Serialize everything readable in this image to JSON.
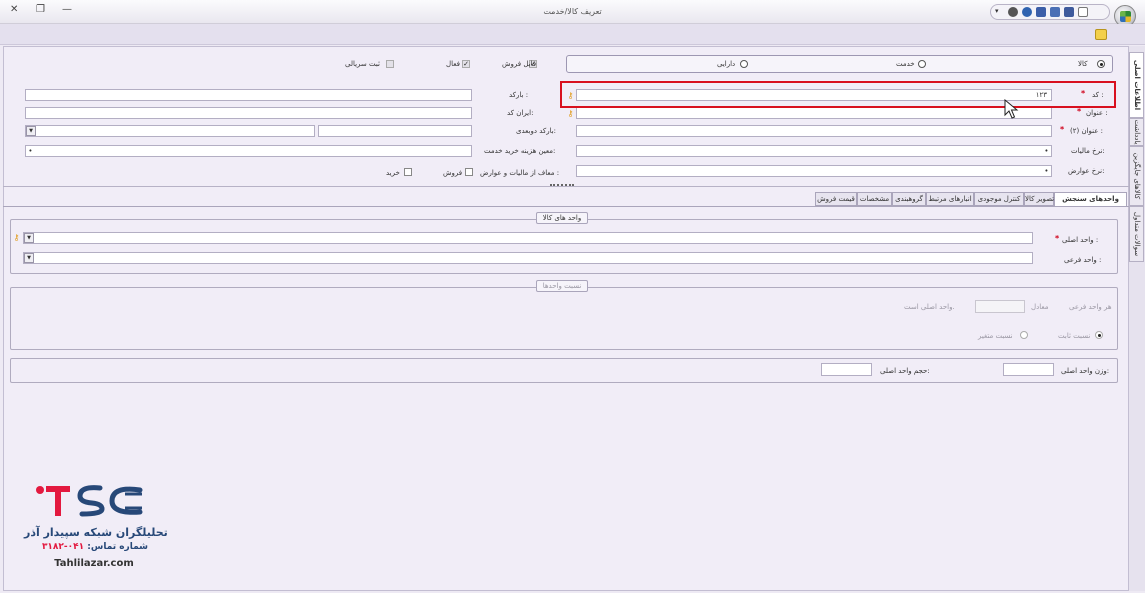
{
  "window": {
    "title": "تعریف کالا/خدمت",
    "close": "✕",
    "restore": "❐",
    "minimize": "—"
  },
  "vertical_tabs": [
    "اطلاعات اصلی",
    "یادداشت",
    "کالاهای جایگزین",
    "سوالات متداول"
  ],
  "item_type": {
    "options": [
      "کالا",
      "خدمت",
      "دارایی"
    ],
    "selected": "کالا"
  },
  "flags": {
    "sellable": "قابل فروش",
    "active": "فعال",
    "serial": "ثبت سریالی"
  },
  "fields": {
    "code_label": "کد :",
    "code_value": "۱۲۳",
    "barcode_label": "بارکد :",
    "title_label": "عنوان :",
    "iran_code_label": "ایران کد:",
    "title2_label": "عنوان (۲) :",
    "double_barcode_label": "بارکد دوبعدی:",
    "tax_rate_label": "نرخ مالیات:",
    "service_purchase_cost_label": "معین هزینه خرید خدمت:",
    "duty_rate_label": "نرخ عوارض:",
    "tax_exempt_label": "معاف از مالیات و عوارض :",
    "sale_label": "فروش",
    "purchase_label": "خرید"
  },
  "tabs": [
    "واحدهای سنجش",
    "تصویر کالا",
    "کنترل موجودی",
    "انبارهای مرتبط",
    "گروهبندی",
    "مشخصات",
    "قیمت فروش"
  ],
  "units": {
    "group_title": "واحد های کالا",
    "main_unit_label": "واحد اصلی :",
    "sub_unit_label": "واحد فرعی :"
  },
  "ratio": {
    "group_title": "نسبت واحدها",
    "each_sub_unit": "هر واحد فرعی",
    "equals": "معادل",
    "main_unit_is": "واحد اصلی است.",
    "fixed_ratio": "نسبت ثابت",
    "variable_ratio": "نسبت متغیر"
  },
  "measures": {
    "weight_label": "وزن واحد اصلی:",
    "volume_label": "حجم واحد اصلی:"
  },
  "branding": {
    "company": "تحلیلگران شبکه سپیدار آذر",
    "phone_label": "شماره تماس:",
    "phone": "۰۴۱-۳۱۸۲",
    "website": "Tahlilazar.com"
  }
}
